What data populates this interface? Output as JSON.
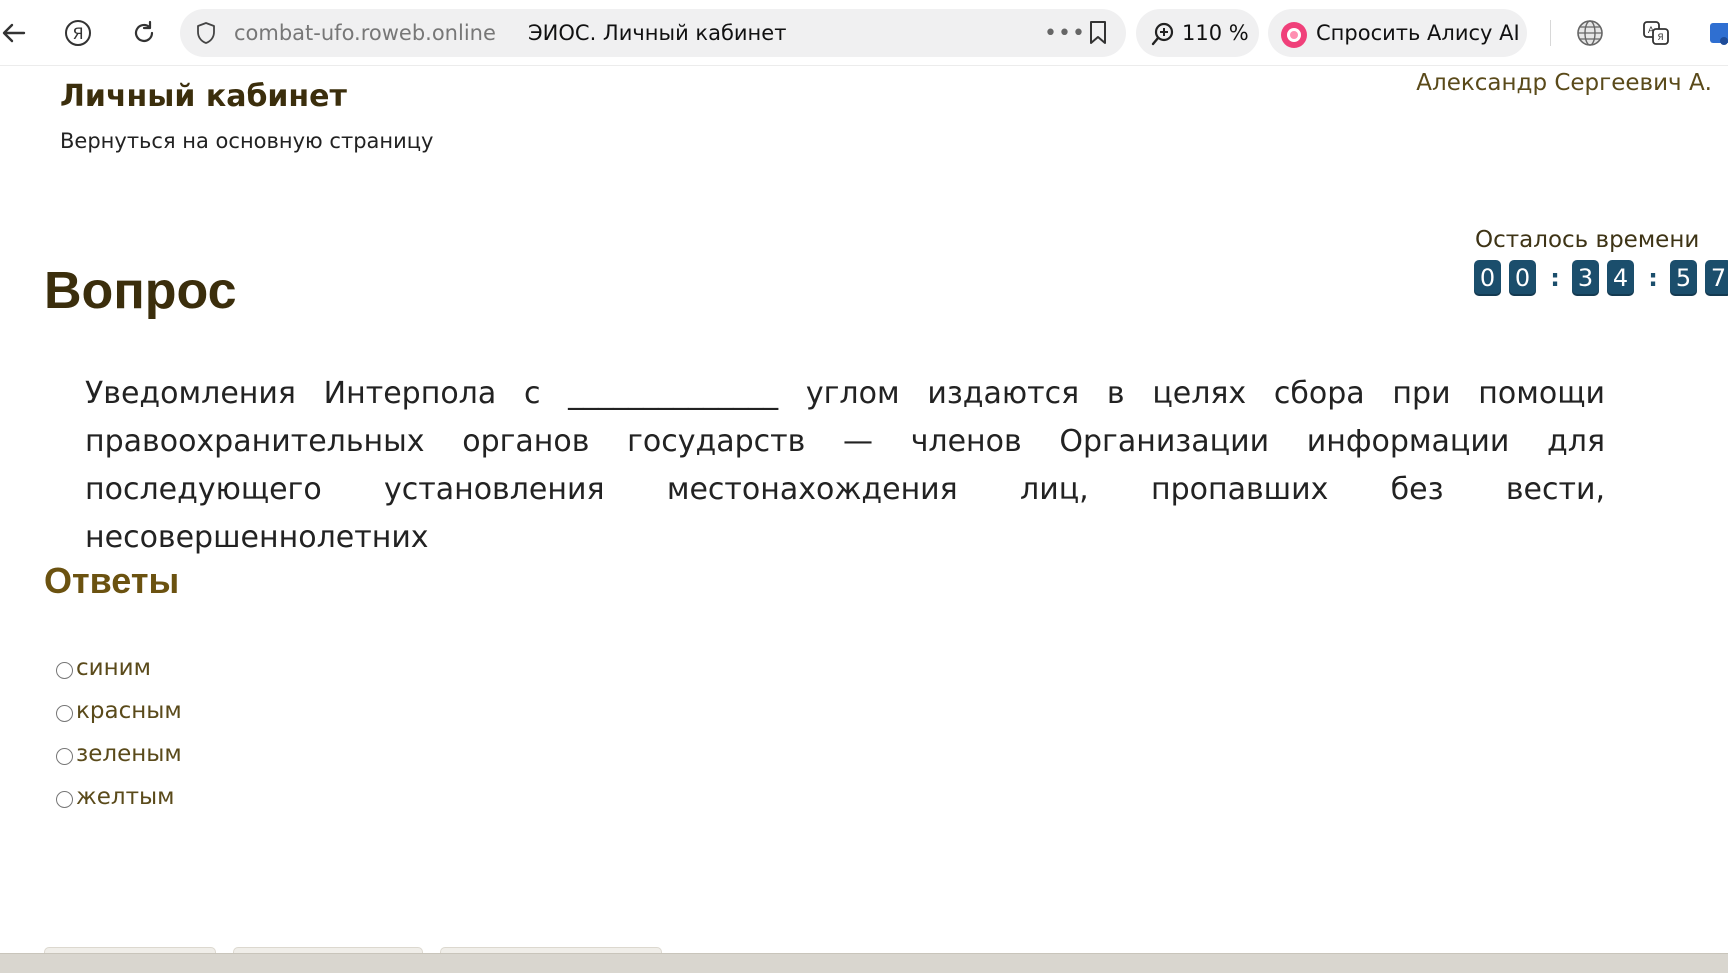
{
  "browser": {
    "address": {
      "domain": "combat-ufo.roweb.online",
      "page_title": "ЭИОС. Личный кабинет"
    },
    "zoom": "110 %",
    "alice_label": "Спросить Алису AI",
    "icons": [
      "back-arrow-icon",
      "yandex-logo-icon",
      "reload-icon",
      "shield-icon",
      "more-dots-icon",
      "bookmark-icon",
      "zoom-icon",
      "alice-icon",
      "globe-icon",
      "translate-icon"
    ]
  },
  "header": {
    "title": "Личный кабинет",
    "back_link": "Вернуться на основную страницу",
    "user_name": "Александр Сергеевич А."
  },
  "timer": {
    "label": "Осталось времени",
    "hours": [
      "0",
      "0"
    ],
    "minutes": [
      "3",
      "4"
    ],
    "seconds": [
      "5",
      "7"
    ],
    "digit_color": "#1b4e6c"
  },
  "question": {
    "heading": "Вопрос",
    "text": "Уведомления Интерпола с ______________ углом издаются в целях сбора при помощи правоохранительных органов государств — членов Организации информации для последующего установления местонахождения лиц, пропавших без вести, несовершеннолетних"
  },
  "answers": {
    "heading": "Ответы",
    "options": [
      "синим",
      "красным",
      "зеленым",
      "желтым"
    ],
    "selected": null
  },
  "colors": {
    "heading_brown": "#3b2e0c",
    "answers_heading": "#6b5210",
    "alice_accent": "#f0407a"
  }
}
